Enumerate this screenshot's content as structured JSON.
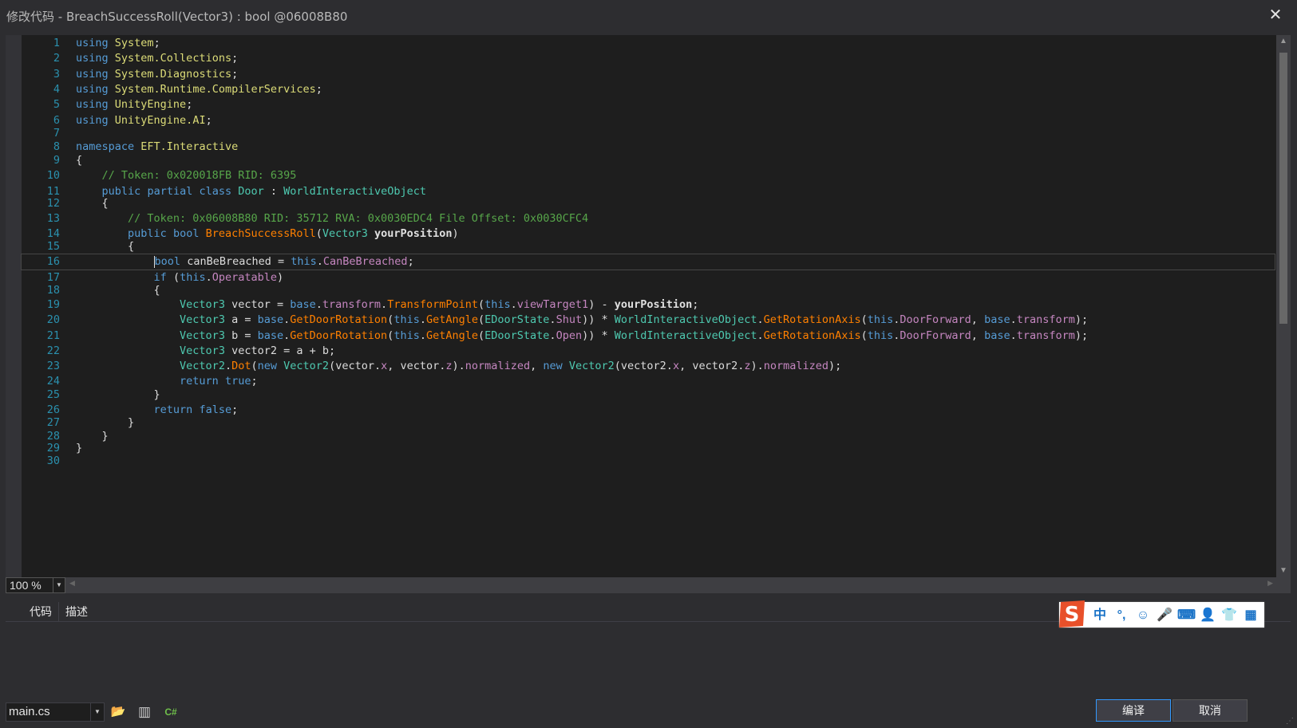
{
  "window": {
    "title": "修改代码 - BreachSuccessRoll(Vector3) : bool @06008B80",
    "close_glyph": "✕"
  },
  "editor": {
    "zoom": "100 %",
    "lines": [
      {
        "n": "1",
        "html": "<span class=\"kw\">using</span> <span class=\"ns\">System</span>;"
      },
      {
        "n": "2",
        "html": "<span class=\"kw\">using</span> <span class=\"ns\">System.Collections</span>;"
      },
      {
        "n": "3",
        "html": "<span class=\"kw\">using</span> <span class=\"ns\">System.Diagnostics</span>;"
      },
      {
        "n": "4",
        "html": "<span class=\"kw\">using</span> <span class=\"ns\">System.Runtime.CompilerServices</span>;"
      },
      {
        "n": "5",
        "html": "<span class=\"kw\">using</span> <span class=\"ns\">UnityEngine</span>;"
      },
      {
        "n": "6",
        "html": "<span class=\"kw\">using</span> <span class=\"ns\">UnityEngine.AI</span>;"
      },
      {
        "n": "7",
        "html": ""
      },
      {
        "n": "8",
        "html": "<span class=\"kw\">namespace</span> <span class=\"ns\">EFT.Interactive</span>"
      },
      {
        "n": "9",
        "html": "{"
      },
      {
        "n": "10",
        "html": "    <span class=\"cm\">// Token: 0x020018FB RID: 6395</span>"
      },
      {
        "n": "11",
        "html": "    <span class=\"kw\">public</span> <span class=\"kw\">partial</span> <span class=\"kw\">class</span> <span class=\"ty\">Door</span> : <span class=\"ty\">WorldInteractiveObject</span>"
      },
      {
        "n": "12",
        "html": "    {"
      },
      {
        "n": "13",
        "html": "        <span class=\"cm\">// Token: 0x06008B80 RID: 35712 RVA: 0x0030EDC4 File Offset: 0x0030CFC4</span>"
      },
      {
        "n": "14",
        "html": "        <span class=\"kw\">public</span> <span class=\"kw\">bool</span> <span class=\"mt\">BreachSuccessRoll</span>(<span class=\"ty\">Vector3</span> <span class=\"bp\">yourPosition</span>)"
      },
      {
        "n": "15",
        "html": "        {"
      },
      {
        "n": "16",
        "html": "            <span class=\"caret\"></span><span class=\"kw\">bool</span> canBeBreached = <span class=\"kw\">this</span>.<span class=\"pr\">CanBeBreached</span>;",
        "current": true
      },
      {
        "n": "17",
        "html": "            <span class=\"kw\">if</span> (<span class=\"kw\">this</span>.<span class=\"pr\">Operatable</span>)"
      },
      {
        "n": "18",
        "html": "            {"
      },
      {
        "n": "19",
        "html": "                <span class=\"ty\">Vector3</span> vector = <span class=\"kw\">base</span>.<span class=\"pr\">transform</span>.<span class=\"mt\">TransformPoint</span>(<span class=\"kw\">this</span>.<span class=\"pr\">viewTarget1</span>) - <span class=\"bp\">yourPosition</span>;"
      },
      {
        "n": "20",
        "html": "                <span class=\"ty\">Vector3</span> a = <span class=\"kw\">base</span>.<span class=\"mt\">GetDoorRotation</span>(<span class=\"kw\">this</span>.<span class=\"mt\">GetAngle</span>(<span class=\"ty\">EDoorState</span>.<span class=\"pr\">Shut</span>)) * <span class=\"ty\">WorldInteractiveObject</span>.<span class=\"mt\">GetRotationAxis</span>(<span class=\"kw\">this</span>.<span class=\"pr\">DoorForward</span>, <span class=\"kw\">base</span>.<span class=\"pr\">transform</span>);"
      },
      {
        "n": "21",
        "html": "                <span class=\"ty\">Vector3</span> b = <span class=\"kw\">base</span>.<span class=\"mt\">GetDoorRotation</span>(<span class=\"kw\">this</span>.<span class=\"mt\">GetAngle</span>(<span class=\"ty\">EDoorState</span>.<span class=\"pr\">Open</span>)) * <span class=\"ty\">WorldInteractiveObject</span>.<span class=\"mt\">GetRotationAxis</span>(<span class=\"kw\">this</span>.<span class=\"pr\">DoorForward</span>, <span class=\"kw\">base</span>.<span class=\"pr\">transform</span>);"
      },
      {
        "n": "22",
        "html": "                <span class=\"ty\">Vector3</span> vector2 = a + b;"
      },
      {
        "n": "23",
        "html": "                <span class=\"ty\">Vector2</span>.<span class=\"mt\">Dot</span>(<span class=\"kw\">new</span> <span class=\"ty\">Vector2</span>(vector.<span class=\"pr\">x</span>, vector.<span class=\"pr\">z</span>).<span class=\"pr\">normalized</span>, <span class=\"kw\">new</span> <span class=\"ty\">Vector2</span>(vector2.<span class=\"pr\">x</span>, vector2.<span class=\"pr\">z</span>).<span class=\"pr\">normalized</span>);"
      },
      {
        "n": "24",
        "html": "                <span class=\"kw\">return</span> <span class=\"kw\">true</span>;"
      },
      {
        "n": "25",
        "html": "            }"
      },
      {
        "n": "26",
        "html": "            <span class=\"kw\">return</span> <span class=\"kw\">false</span>;"
      },
      {
        "n": "27",
        "html": "        }"
      },
      {
        "n": "28",
        "html": "    }"
      },
      {
        "n": "29",
        "html": "}"
      },
      {
        "n": "30",
        "html": ""
      }
    ]
  },
  "tabs": [
    "代码",
    "描述"
  ],
  "ime": {
    "items": [
      {
        "name": "ime-chinese-mode-icon",
        "glyph": "中"
      },
      {
        "name": "ime-punctuation-icon",
        "glyph": "°,"
      },
      {
        "name": "ime-emoji-icon",
        "glyph": "☺"
      },
      {
        "name": "ime-voice-icon",
        "glyph": "🎤"
      },
      {
        "name": "ime-keyboard-icon",
        "glyph": "⌨"
      },
      {
        "name": "ime-user-icon",
        "glyph": "👤"
      },
      {
        "name": "ime-skin-icon",
        "glyph": "👕"
      },
      {
        "name": "ime-toolbox-icon",
        "glyph": "▦"
      }
    ],
    "logo_color": "#e8502a"
  },
  "bottom": {
    "file": "main.cs",
    "open_icon": "📂",
    "assembly_icon": "▥",
    "lang_label": "C#",
    "compile_label": "编译",
    "cancel_label": "取消"
  }
}
